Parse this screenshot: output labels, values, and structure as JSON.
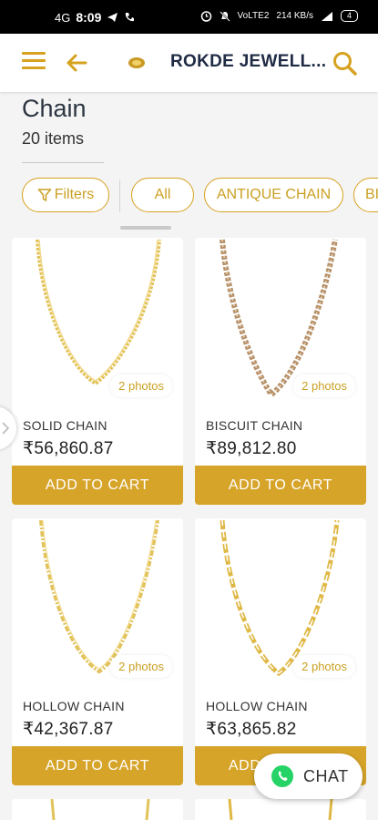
{
  "status_bar": {
    "network": "4G",
    "time": "8:09",
    "speed": "214 KB/s",
    "network_type": "VoLTE2",
    "battery": "4"
  },
  "app_bar": {
    "title": "ROKDE JEWELL...",
    "menu_icon": "menu-icon",
    "back_icon": "arrow-left-icon",
    "search_icon": "search-icon",
    "brand_color": "#d6a21f"
  },
  "category": {
    "title": "Chain",
    "count": "20 items"
  },
  "filters": {
    "filter_label": "Filters",
    "chips": [
      "All",
      "ANTIQUE CHAIN",
      "BI"
    ]
  },
  "products": [
    {
      "name": "SOLID CHAIN",
      "price": "₹56,860.87",
      "photos": "2 photos",
      "cart": "ADD TO CART",
      "chain_color": "#e3c35a"
    },
    {
      "name": "BISCUIT CHAIN",
      "price": "₹89,812.80",
      "photos": "2 photos",
      "cart": "ADD TO CART",
      "chain_color": "#b79169"
    },
    {
      "name": "HOLLOW CHAIN",
      "price": "₹42,367.87",
      "photos": "2 photos",
      "cart": "ADD TO CART",
      "chain_color": "#e2c25a"
    },
    {
      "name": "HOLLOW CHAIN",
      "price": "₹63,865.82",
      "photos": "2 photos",
      "cart": "ADD TO CART",
      "chain_color": "#dfb845"
    }
  ],
  "chat": {
    "label": "CHAT"
  }
}
